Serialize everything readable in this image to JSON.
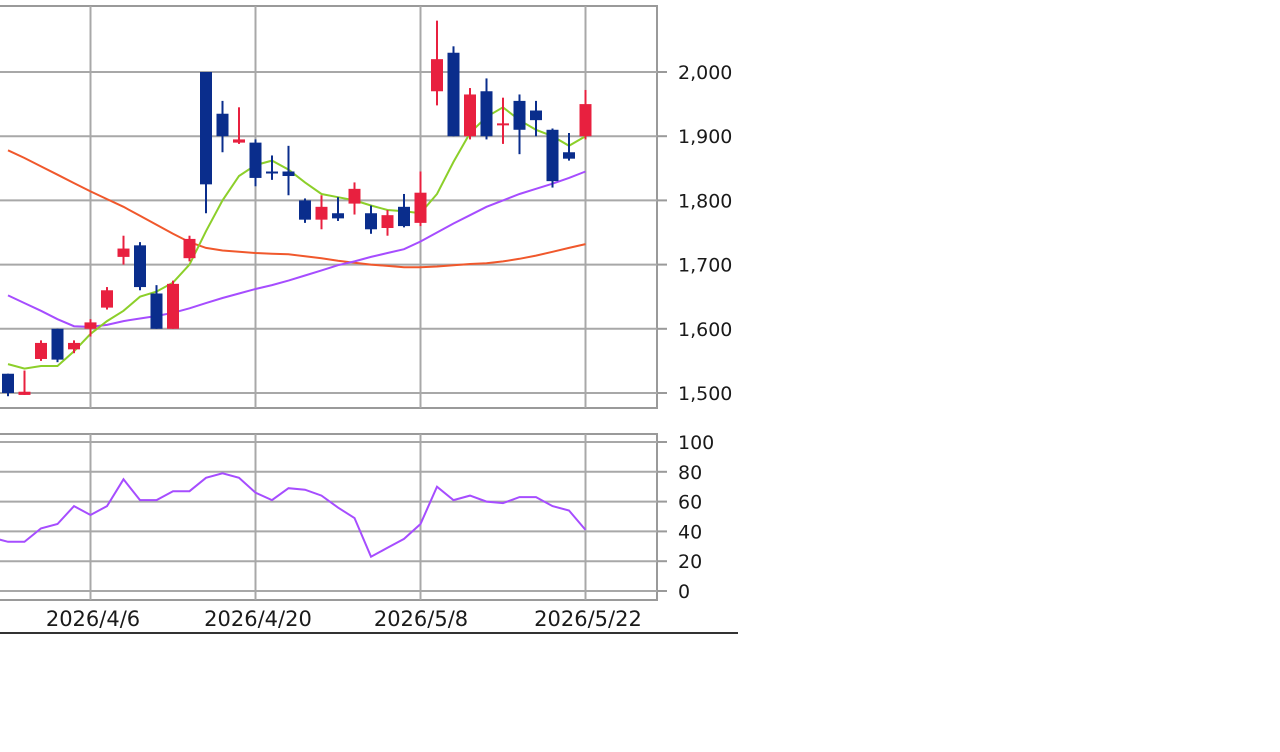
{
  "chart_data": [
    {
      "type": "candlestick",
      "title": "",
      "ylim": [
        1490,
        2100
      ],
      "yticks": [
        "1,500",
        "1,600",
        "1,700",
        "1,800",
        "1,900",
        "2,000"
      ],
      "ytick_values": [
        1500,
        1600,
        1700,
        1800,
        1900,
        2000
      ],
      "colors": {
        "up": "#e8203f",
        "down": "#0a2d8c",
        "ma_short": "#8ccf2a",
        "ma_mid": "#a64dff",
        "ma_long": "#f0582c"
      },
      "candles": [
        {
          "o": 1530,
          "h": 1530,
          "l": 1495,
          "c": 1500
        },
        {
          "o": 1497,
          "h": 1535,
          "l": 1497,
          "c": 1502
        },
        {
          "o": 1553,
          "h": 1582,
          "l": 1550,
          "c": 1578
        },
        {
          "o": 1600,
          "h": 1600,
          "l": 1548,
          "c": 1552
        },
        {
          "o": 1568,
          "h": 1582,
          "l": 1562,
          "c": 1578
        },
        {
          "o": 1600,
          "h": 1615,
          "l": 1588,
          "c": 1610
        },
        {
          "o": 1633,
          "h": 1665,
          "l": 1630,
          "c": 1660
        },
        {
          "o": 1712,
          "h": 1745,
          "l": 1700,
          "c": 1725
        },
        {
          "o": 1730,
          "h": 1735,
          "l": 1660,
          "c": 1665
        },
        {
          "o": 1655,
          "h": 1668,
          "l": 1600,
          "c": 1600
        },
        {
          "o": 1600,
          "h": 1675,
          "l": 1600,
          "c": 1670
        },
        {
          "o": 1710,
          "h": 1745,
          "l": 1705,
          "c": 1740
        },
        {
          "o": 2000,
          "h": 2000,
          "l": 1780,
          "c": 1825
        },
        {
          "o": 1935,
          "h": 1955,
          "l": 1875,
          "c": 1900
        },
        {
          "o": 1890,
          "h": 1945,
          "l": 1888,
          "c": 1895
        },
        {
          "o": 1890,
          "h": 1895,
          "l": 1822,
          "c": 1835
        },
        {
          "o": 1845,
          "h": 1870,
          "l": 1832,
          "c": 1843
        },
        {
          "o": 1845,
          "h": 1885,
          "l": 1808,
          "c": 1838
        },
        {
          "o": 1800,
          "h": 1803,
          "l": 1765,
          "c": 1770
        },
        {
          "o": 1770,
          "h": 1808,
          "l": 1755,
          "c": 1790
        },
        {
          "o": 1780,
          "h": 1805,
          "l": 1768,
          "c": 1772
        },
        {
          "o": 1795,
          "h": 1828,
          "l": 1778,
          "c": 1818
        },
        {
          "o": 1780,
          "h": 1792,
          "l": 1748,
          "c": 1755
        },
        {
          "o": 1757,
          "h": 1785,
          "l": 1745,
          "c": 1777
        },
        {
          "o": 1790,
          "h": 1810,
          "l": 1758,
          "c": 1760
        },
        {
          "o": 1765,
          "h": 1845,
          "l": 1760,
          "c": 1812
        },
        {
          "o": 1970,
          "h": 2080,
          "l": 1948,
          "c": 2020
        },
        {
          "o": 2030,
          "h": 2040,
          "l": 1900,
          "c": 1900
        },
        {
          "o": 1900,
          "h": 1975,
          "l": 1895,
          "c": 1965
        },
        {
          "o": 1970,
          "h": 1990,
          "l": 1895,
          "c": 1900
        },
        {
          "o": 1920,
          "h": 1960,
          "l": 1888,
          "c": 1920
        },
        {
          "o": 1955,
          "h": 1965,
          "l": 1872,
          "c": 1910
        },
        {
          "o": 1940,
          "h": 1955,
          "l": 1900,
          "c": 1925
        },
        {
          "o": 1910,
          "h": 1912,
          "l": 1820,
          "c": 1830
        },
        {
          "o": 1875,
          "h": 1905,
          "l": 1862,
          "c": 1865
        },
        {
          "o": 1900,
          "h": 1972,
          "l": 1895,
          "c": 1950
        }
      ],
      "ma_short": [
        1545,
        1538,
        1542,
        1542,
        1565,
        1592,
        1612,
        1628,
        1650,
        1658,
        1672,
        1700,
        1752,
        1800,
        1838,
        1855,
        1862,
        1848,
        1828,
        1810,
        1805,
        1800,
        1792,
        1785,
        1783,
        1780,
        1810,
        1860,
        1905,
        1930,
        1945,
        1925,
        1910,
        1900,
        1885,
        1900
      ],
      "ma_mid": [
        1652,
        1640,
        1628,
        1615,
        1604,
        1603,
        1606,
        1612,
        1616,
        1620,
        1625,
        1632,
        1640,
        1648,
        1655,
        1662,
        1668,
        1675,
        1683,
        1691,
        1699,
        1705,
        1712,
        1718,
        1724,
        1736,
        1750,
        1764,
        1777,
        1790,
        1800,
        1810,
        1818,
        1826,
        1835,
        1845
      ],
      "ma_long": [
        1878,
        1866,
        1853,
        1840,
        1827,
        1814,
        1802,
        1790,
        1776,
        1762,
        1748,
        1735,
        1726,
        1722,
        1720,
        1718,
        1717,
        1716,
        1713,
        1710,
        1706,
        1703,
        1700,
        1698,
        1696,
        1696,
        1697,
        1699,
        1701,
        1702,
        1705,
        1709,
        1714,
        1720,
        1726,
        1732
      ],
      "x_gridlines_at_index": [
        5,
        15,
        25,
        35
      ]
    },
    {
      "type": "line",
      "title": "",
      "ylim": [
        0,
        100
      ],
      "yticks": [
        "100",
        "80",
        "60",
        "40",
        "20",
        "0"
      ],
      "ytick_values": [
        100,
        80,
        60,
        40,
        20,
        0
      ],
      "color": "#a64dff",
      "values": [
        36,
        33,
        33,
        42,
        45,
        57,
        51,
        57,
        75,
        61,
        61,
        67,
        67,
        76,
        79,
        76,
        66,
        61,
        69,
        68,
        64,
        56,
        49,
        23,
        29,
        35,
        45,
        70,
        61,
        64,
        60,
        59,
        63,
        63,
        57,
        54,
        41
      ]
    }
  ],
  "x_axis": {
    "labels": [
      "2026/4/6",
      "2026/4/20",
      "2026/5/8",
      "2026/5/22"
    ]
  }
}
